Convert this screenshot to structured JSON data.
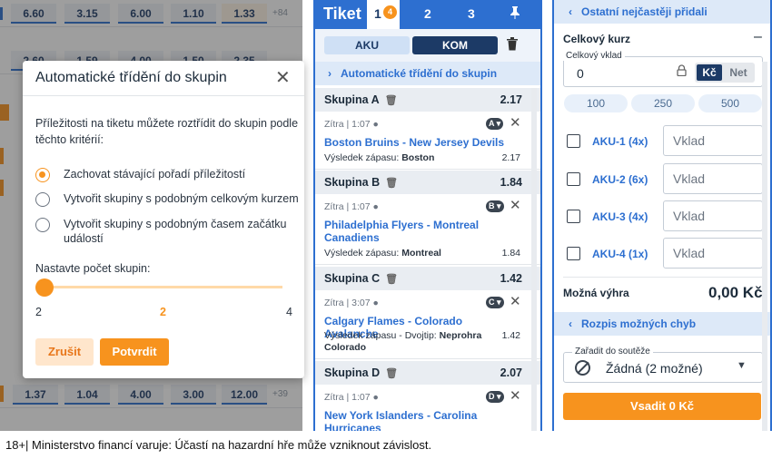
{
  "odds_rows": [
    {
      "cells": [
        "6.60",
        "3.15",
        "6.00",
        "1.10",
        "1.33"
      ],
      "more": "+84"
    },
    {
      "cells": [
        "2.60",
        "1.59",
        "4.00",
        "1.50",
        "2.35"
      ],
      "more": ""
    },
    {
      "cells": [
        "",
        "",
        "",
        "",
        "",
        ""
      ],
      "more": ""
    },
    {
      "cells": [
        "",
        "",
        "",
        "",
        "",
        ""
      ],
      "more": ""
    },
    {
      "cells": [
        "",
        "",
        "",
        "",
        "",
        ""
      ],
      "more": ""
    },
    {
      "cells": [
        "",
        "",
        "",
        "",
        "",
        ""
      ],
      "more": ""
    },
    {
      "cells": [
        "",
        "",
        "",
        "",
        "",
        ""
      ],
      "more": ""
    },
    {
      "cells": [
        "",
        "",
        "",
        "",
        "",
        ""
      ],
      "more": ""
    },
    {
      "cells": [
        "",
        "",
        "",
        "",
        "",
        ""
      ],
      "more": ""
    },
    {
      "cells": [
        "",
        "",
        "",
        "",
        "",
        ""
      ],
      "more": ""
    },
    {
      "cells": [
        "",
        "",
        "",
        "",
        "",
        ""
      ],
      "more": ""
    },
    {
      "cells": [
        "",
        "",
        "",
        "",
        "",
        ""
      ],
      "more": ""
    },
    {
      "cells": [
        "",
        "",
        "",
        "",
        "",
        ""
      ],
      "more": ""
    },
    {
      "cells": [
        "",
        "",
        "",
        "",
        "",
        ""
      ],
      "more": ""
    },
    {
      "cells": [
        "1.37",
        "1.04",
        "4.00",
        "3.00",
        "12.00"
      ],
      "more": "+39"
    }
  ],
  "modal": {
    "title": "Automatické třídění do skupin",
    "description": "Příležitosti na tiketu můžete roztřídit do skupin podle těchto kritérií:",
    "options": [
      "Zachovat stávající pořadí příležitostí",
      "Vytvořit skupiny s podobným celkovým kurzem",
      "Vytvořit skupiny s podobným časem začátku událostí"
    ],
    "count_label": "Nastavte počet skupin:",
    "slider_min": "2",
    "slider_value": "2",
    "slider_max": "4",
    "cancel_label": "Zrušit",
    "confirm_label": "Potvrdit"
  },
  "ticket": {
    "title": "Tiket",
    "tabs": [
      "1",
      "2",
      "3"
    ],
    "tab1_badge": "4",
    "aku_label": "AKU",
    "kom_label": "KOM",
    "auto_group_label": "Automatické třídění do skupin",
    "groups": [
      {
        "label": "Skupina A",
        "odds": "2.17",
        "meta": "Zítra | 1:07",
        "badge": "A",
        "event": "Boston Bruins - New Jersey Devils",
        "detail_prefix": "Výsledek zápasu: ",
        "detail": "Boston",
        "event_odds": "2.17"
      },
      {
        "label": "Skupina B",
        "odds": "1.84",
        "meta": "Zítra | 1:07",
        "badge": "B",
        "event": "Philadelphia Flyers - Montreal Canadiens",
        "detail_prefix": "Výsledek zápasu: ",
        "detail": "Montreal",
        "event_odds": "1.84"
      },
      {
        "label": "Skupina C",
        "odds": "1.42",
        "meta": "Zítra | 3:07",
        "badge": "C",
        "event": "Calgary Flames - Colorado Avalanche",
        "detail_prefix": "Výsledek zápasu - Dvojtip: ",
        "detail": "Neprohra Colorado",
        "event_odds": "1.42"
      },
      {
        "label": "Skupina D",
        "odds": "2.07",
        "meta": "Zítra | 1:07",
        "badge": "D",
        "event": "New York Islanders - Carolina Hurricanes",
        "detail_prefix": "",
        "detail": "",
        "event_odds": ""
      }
    ]
  },
  "right": {
    "others_label": "Ostatní nejčastěji přidali",
    "total_odds_label": "Celkový kurz",
    "total_odds_toggle": "–",
    "stake_legend": "Celkový vklad",
    "stake_value": "0",
    "currency_kc": "Kč",
    "currency_net": "Net",
    "quick_amounts": [
      "100",
      "250",
      "500"
    ],
    "aku_rows": [
      {
        "label": "AKU-1 (4x)",
        "placeholder": "Vklad"
      },
      {
        "label": "AKU-2 (6x)",
        "placeholder": "Vklad"
      },
      {
        "label": "AKU-3 (4x)",
        "placeholder": "Vklad"
      },
      {
        "label": "AKU-4 (1x)",
        "placeholder": "Vklad"
      }
    ],
    "possible_win_label": "Možná výhra",
    "possible_win_value": "0,00 Kč",
    "errors_label": "Rozpis možných chyb",
    "competition_legend": "Zařadit do soutěže",
    "competition_value": "Žádná (2 možné)",
    "bet_label": "Vsadit 0 Kč"
  },
  "footer": {
    "text": "18+| Ministerstvo financí varuje: Účastí na hazardní hře může vzniknout závislost."
  },
  "colors": {
    "accent": "#2d6fd0",
    "orange": "#f7931e",
    "navy": "#1c3a66"
  }
}
